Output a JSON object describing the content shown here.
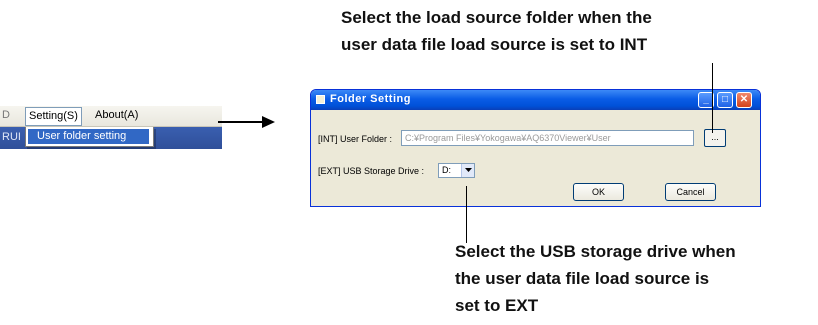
{
  "callouts": {
    "top": [
      "Select the load source folder when the",
      "user data file load source is set to INT"
    ],
    "bottom": [
      "Select the USB storage drive when",
      "the user data file load source is",
      "set to EXT"
    ]
  },
  "menu": {
    "left_fragment": "D",
    "row2_fragment": "RUI",
    "setting_label": "Setting(S)",
    "about_label": "About(A)",
    "dropdown_item": "User folder setting"
  },
  "dialog": {
    "title": "Folder Setting",
    "title_buttons": {
      "minimize": "_",
      "maximize": "□",
      "close": "✕"
    },
    "int_label": "[INT] User Folder :",
    "folder_path": "C:¥Program Files¥Yokogawa¥AQ6370Viewer¥User",
    "browse_label": "...",
    "ext_label": "[EXT] USB Storage Drive :",
    "drive_value": "D:",
    "ok_label": "OK",
    "cancel_label": "Cancel"
  },
  "icons": [
    "right-arrow-icon",
    "window-icon",
    "chevron-down-icon"
  ],
  "colors": {
    "titlebar": "#0a5ce6",
    "dialog_bg": "#ece9d8",
    "menu_highlight": "#3168c5"
  }
}
